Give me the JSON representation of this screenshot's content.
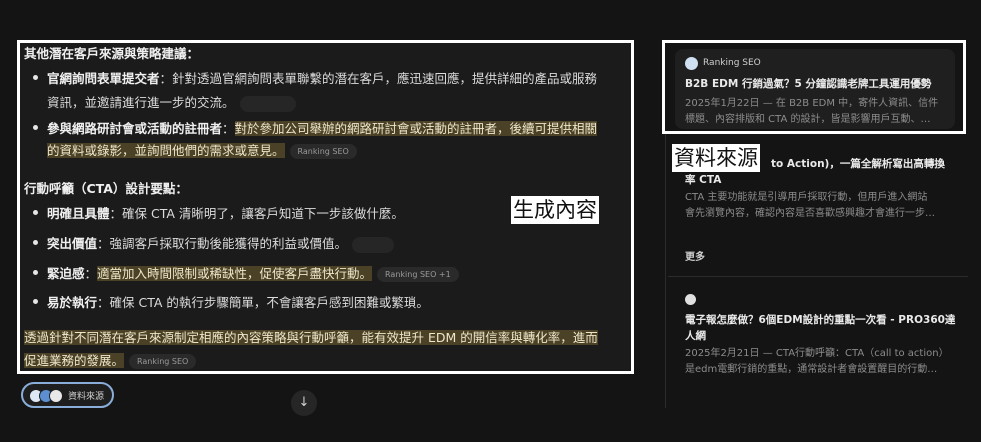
{
  "main": {
    "heading1": "其他潛在客戶來源與策略建議：",
    "items1": [
      {
        "bold": "官網詢問表單提交者",
        "text_line1": "：針對透過官網詢問表單聯繫的潛在客戶，應迅速回應，提供詳細的產品或服務",
        "text_line2": "資訊，並邀請進行進一步的交流。"
      },
      {
        "bold": "參與網路研討會或活動的註冊者",
        "colon": "：",
        "hl_line1": "對於參加公司舉辦的網路研討會或活動的註冊者，後續可提供相關",
        "hl_line2": "的資料或錄影，並詢問他們的需求或意見。",
        "chip": "Ranking SEO"
      }
    ],
    "heading2": "行動呼籲（CTA）設計要點：",
    "items2": [
      {
        "bold": "明確且具體",
        "text": "：確保 CTA 清晰明了，讓客戶知道下一步該做什麼。"
      },
      {
        "bold": "突出價值",
        "text": "：強調客戶採取行動後能獲得的利益或價值。"
      },
      {
        "bold": "緊迫感",
        "colon": "：",
        "hl": "適當加入時間限制或稀缺性，促使客戶盡快行動。",
        "chip": "Ranking SEO  +1"
      },
      {
        "bold": "易於執行",
        "text": "：確保 CTA 的執行步驟簡單，不會讓客戶感到困難或繁瑣。"
      }
    ],
    "summary_line1": "透過針對不同潛在客戶來源制定相應的內容策略與行動呼籲，能有效提升 EDM 的開信率與轉化率，進而",
    "summary_line2": "促進業務的發展。",
    "summary_chip": "Ranking SEO",
    "overlay_label": "生成內容"
  },
  "sources_button": {
    "label": "資料來源"
  },
  "scroll_down_icon": "arrow-down-icon",
  "sidebar": {
    "overlay_label": "資料來源",
    "card1": {
      "source": "Ranking SEO",
      "title": "B2B EDM 行銷過氣？5 分鐘認識老牌工具運用優勢",
      "desc_line1": "2025年1月22日 — 在 B2B EDM 中，寄件人資訊、信件",
      "desc_line2": "標題、內容排版和 CTA 的設計，皆是影響用戶互動、…"
    },
    "card2": {
      "title_line1": "to Action)，一篇全解析寫出高轉換",
      "title_line2": "率 CTA",
      "desc_line1": "CTA 主要功能就是引導用戶採取行動，但用戶進入網站",
      "desc_line2": "會先瀏覽內容，確認內容是否喜歡感興趣才會進行一步…"
    },
    "more_label": "更多",
    "card3": {
      "title_line1": "電子報怎麼做？6個EDM設計的重點一次看 - PRO360達",
      "title_line2": "人網",
      "desc_line1": "2025年2月21日 — CTA行動呼籲：CTA（call to action）",
      "desc_line2": "是edm電郵行銷的重點，通常設計者會設置醒目的行動…"
    }
  },
  "colors": {
    "background": "#141414",
    "highlight": "#4a4126",
    "pill_border": "#8aaed9",
    "annotation_box": "#ffffff"
  }
}
